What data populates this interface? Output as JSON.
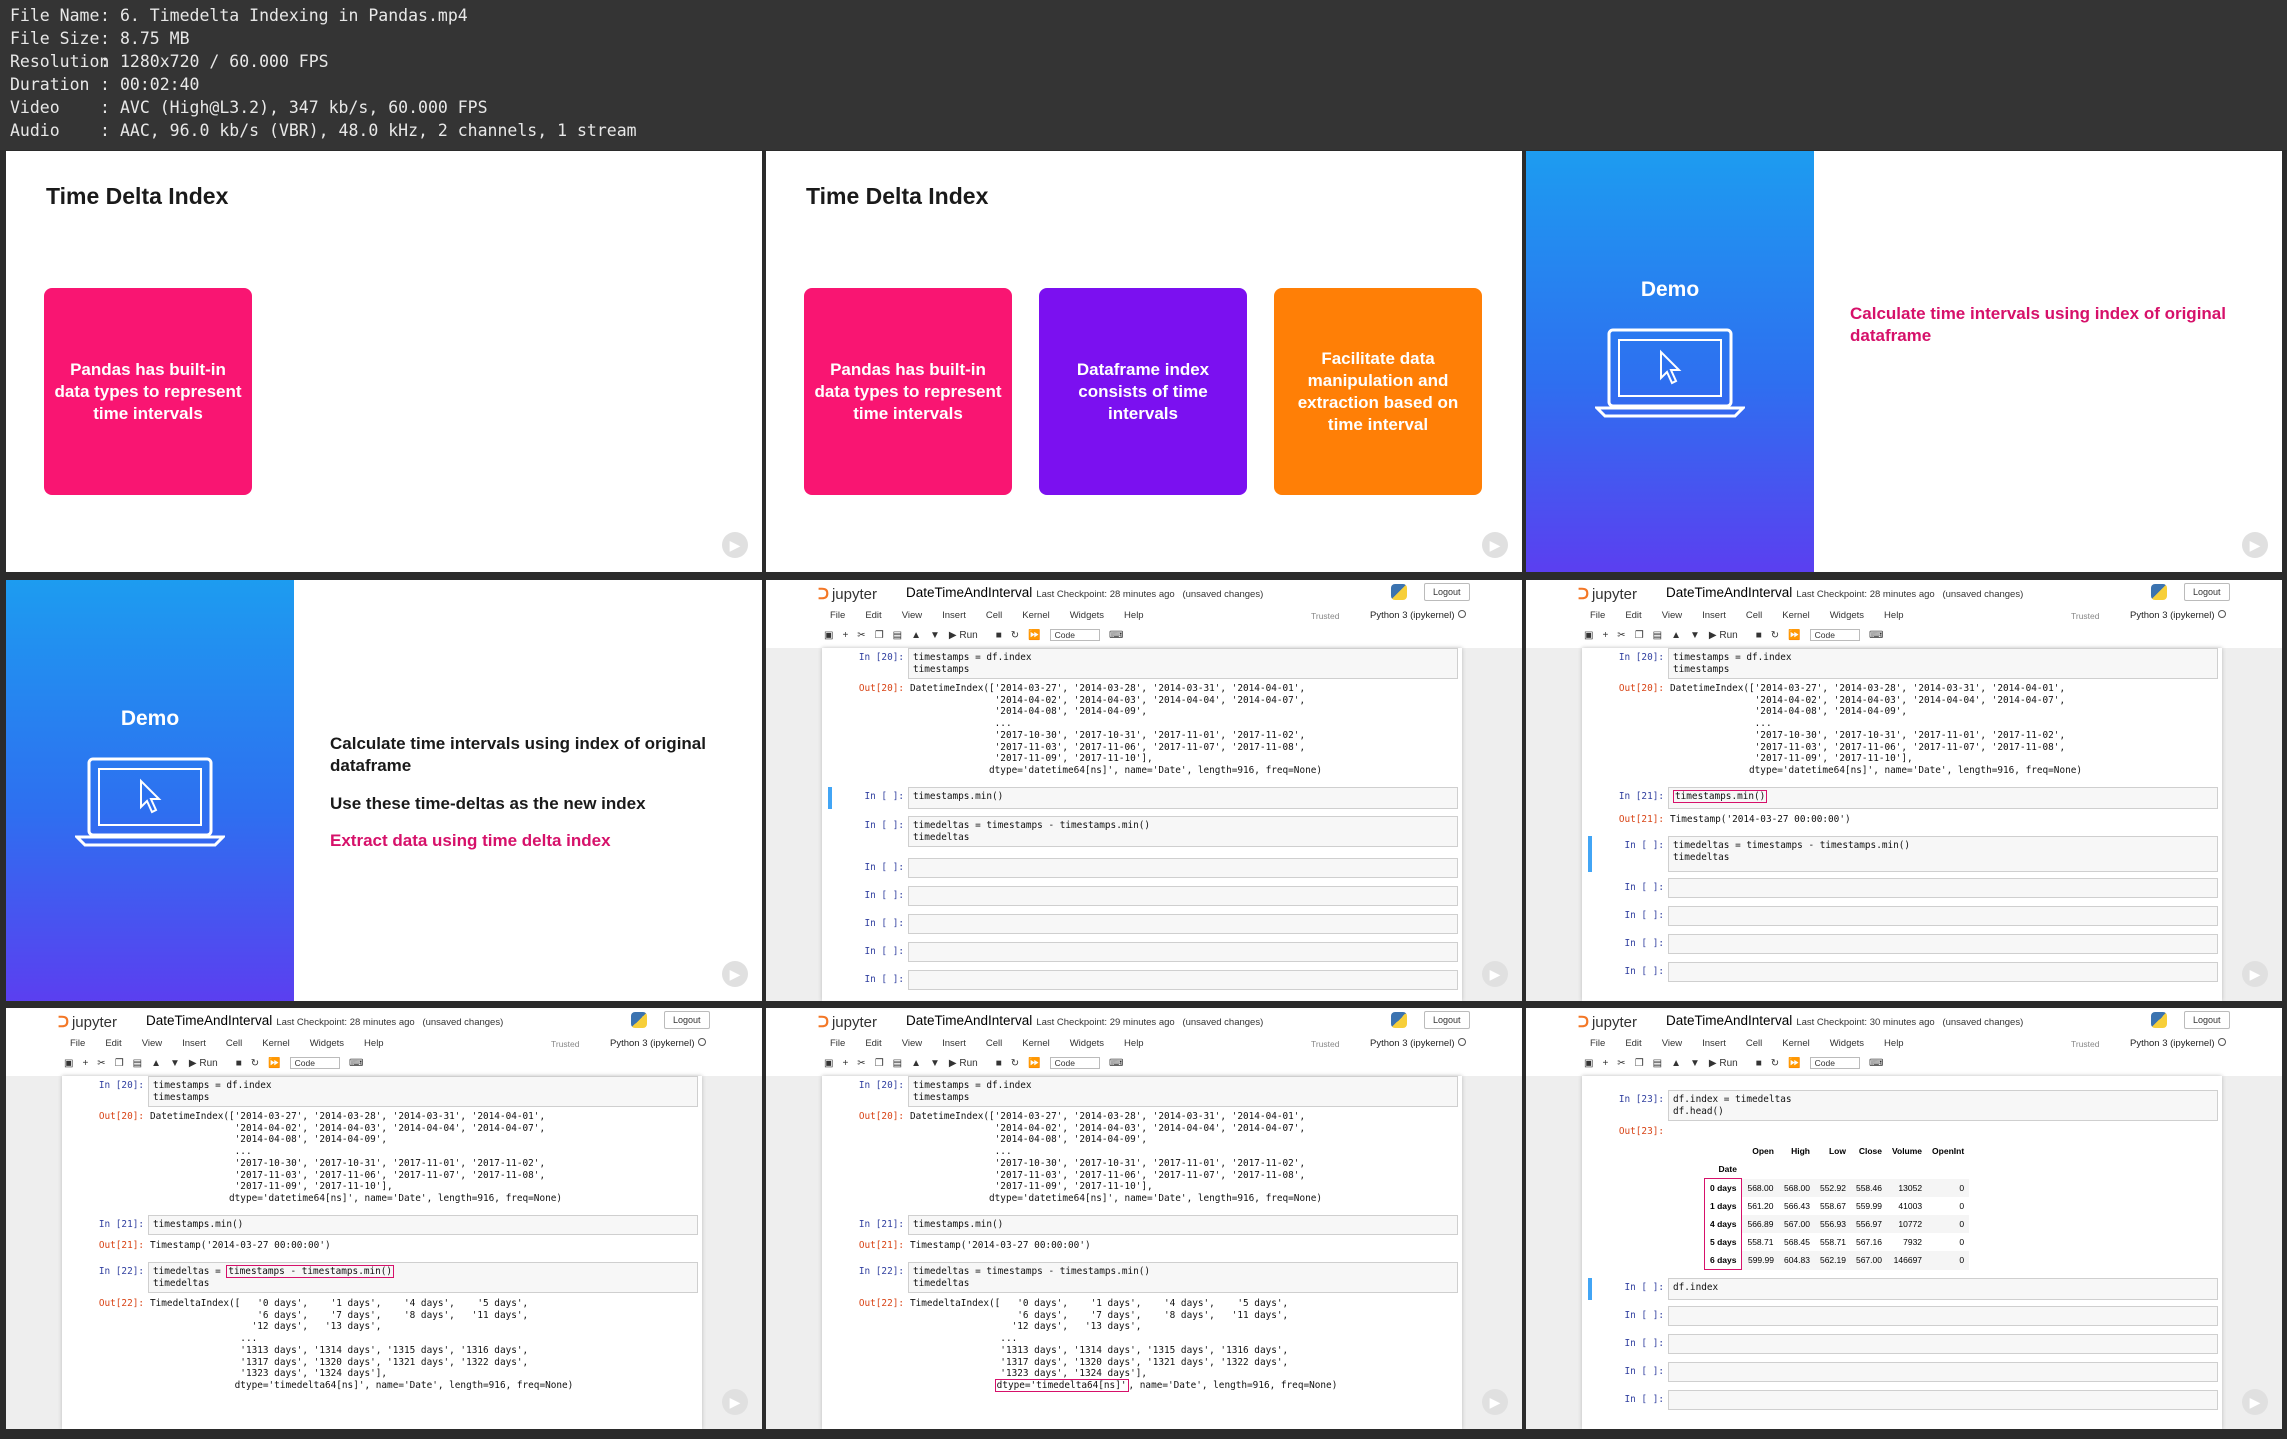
{
  "meta": [
    {
      "key": "File Name",
      "value": "6. Timedelta Indexing in Pandas.mp4"
    },
    {
      "key": "File Size",
      "value": "8.75 MB"
    },
    {
      "key": "Resolution",
      "value": "1280x720 / 60.000 FPS"
    },
    {
      "key": "Duration",
      "value": "00:02:40"
    },
    {
      "key": "Video",
      "value": "AVC (High@L3.2), 347 kb/s, 60.000 FPS"
    },
    {
      "key": "Audio",
      "value": "AAC, 96.0 kb/s (VBR), 48.0 kHz, 2 channels, 1 stream"
    }
  ],
  "slide_title": "Time Delta Index",
  "boxes": {
    "b1": "Pandas has built-in data types to represent time intervals",
    "b2": "Dataframe index consists of time intervals",
    "b3": "Facilitate data manipulation and extraction based on time interval"
  },
  "demo": {
    "label": "Demo",
    "t1": "Calculate time intervals using index of original dataframe",
    "t2": "Use these time-deltas as the new index",
    "t3": "Extract data using time delta index"
  },
  "jupyter": {
    "logo": "jupyter",
    "notebook": "DateTimeAndInterval",
    "checkpoint_28": "Last Checkpoint: 28 minutes ago",
    "checkpoint_29": "Last Checkpoint: 29 minutes ago",
    "checkpoint_30": "Last Checkpoint: 30 minutes ago",
    "unsaved": "(unsaved changes)",
    "logout": "Logout",
    "menu": [
      "File",
      "Edit",
      "View",
      "Insert",
      "Cell",
      "Kernel",
      "Widgets",
      "Help"
    ],
    "trusted": "Trusted",
    "kernel": "Python 3 (ipykernel)",
    "run": "Run",
    "celltype": "Code"
  },
  "code": {
    "p20": "In [20]:",
    "po20": "Out[20]:",
    "p21": "In [21]:",
    "po21": "Out[21]:",
    "p22": "In [22]:",
    "po22": "Out[22]:",
    "p23": "In [23]:",
    "po23": "Out[23]:",
    "pe": "In [ ]:",
    "c20": "timestamps = df.index\ntimestamps",
    "o20": "DatetimeIndex(['2014-03-27', '2014-03-28', '2014-03-31', '2014-04-01',\n               '2014-04-02', '2014-04-03', '2014-04-04', '2014-04-07',\n               '2014-04-08', '2014-04-09',\n               ...\n               '2017-10-30', '2017-10-31', '2017-11-01', '2017-11-02',\n               '2017-11-03', '2017-11-06', '2017-11-07', '2017-11-08',\n               '2017-11-09', '2017-11-10'],\n              dtype='datetime64[ns]', name='Date', length=916, freq=None)",
    "c21": "timestamps.min()",
    "o21": "Timestamp('2014-03-27 00:00:00')",
    "c22": "timedeltas = timestamps - timestamps.min()\ntimedeltas",
    "c22_lhs": "timedeltas = ",
    "c22_rhs": "timestamps - timestamps.min()",
    "c22_l2": "timedeltas",
    "o22": "TimedeltaIndex([   '0 days',    '1 days',    '4 days',    '5 days',\n                   '6 days',    '7 days',    '8 days',   '11 days',\n                  '12 days',   '13 days',\n                ...\n                '1313 days', '1314 days', '1315 days', '1316 days',\n                '1317 days', '1320 days', '1321 days', '1322 days',\n                '1323 days', '1324 days'],\n               dtype='timedelta64[ns]', name='Date', length=916, freq=None)",
    "o22_main": "TimedeltaIndex([   '0 days',    '1 days',    '4 days',    '5 days',\n                   '6 days',    '7 days',    '8 days',   '11 days',\n                  '12 days',   '13 days',\n                ...\n                '1313 days', '1314 days', '1315 days', '1316 days',\n                '1317 days', '1320 days', '1321 days', '1322 days',\n                '1323 days', '1324 days'],\n",
    "o22_pad": "               ",
    "o22_dtype": "dtype='timedelta64[ns]'",
    "o22_rest": ", name='Date', length=916, freq=None)",
    "c23": "df.index = timedeltas\ndf.head()",
    "c24": "df.index"
  },
  "df_table": {
    "index_name": "Date",
    "columns": [
      "Open",
      "High",
      "Low",
      "Close",
      "Volume",
      "OpenInt"
    ],
    "rows": [
      {
        "idx": "0 days",
        "vals": [
          "568.00",
          "568.00",
          "552.92",
          "558.46",
          "13052",
          "0"
        ]
      },
      {
        "idx": "1 days",
        "vals": [
          "561.20",
          "566.43",
          "558.67",
          "559.99",
          "41003",
          "0"
        ]
      },
      {
        "idx": "4 days",
        "vals": [
          "566.89",
          "567.00",
          "556.93",
          "556.97",
          "10772",
          "0"
        ]
      },
      {
        "idx": "5 days",
        "vals": [
          "558.71",
          "568.45",
          "558.71",
          "567.16",
          "7932",
          "0"
        ]
      },
      {
        "idx": "6 days",
        "vals": [
          "599.99",
          "604.83",
          "562.19",
          "567.00",
          "146697",
          "0"
        ]
      }
    ]
  }
}
